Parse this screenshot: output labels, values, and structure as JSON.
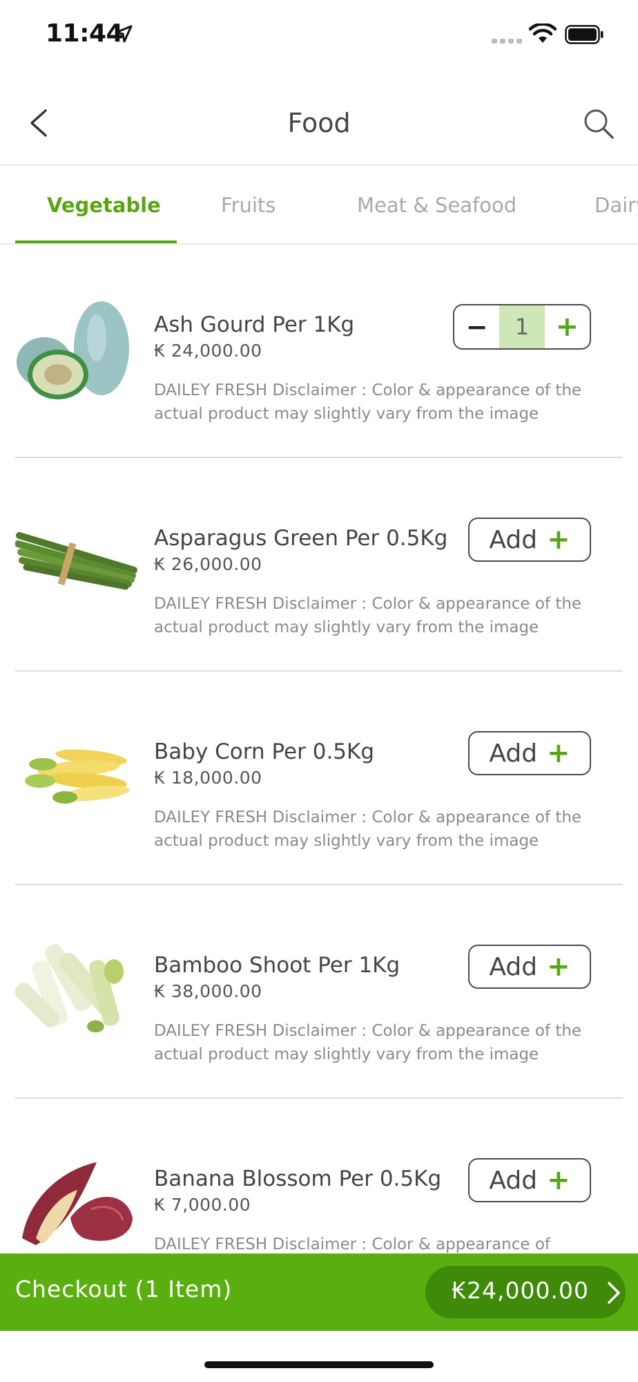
{
  "status": {
    "time": "11:44"
  },
  "nav": {
    "title": "Food"
  },
  "tabs": [
    "Vegetable",
    "Fruits",
    "Meat & Seafood",
    "Dairy"
  ],
  "products": [
    {
      "name": "Ash Gourd Per 1Kg",
      "price": "₭ 24,000.00",
      "disclaimer": "DAILEY FRESH Disclaimer : Color & appearance of the actual product may slightly vary from the image",
      "quantity": "1"
    },
    {
      "name": "Asparagus Green Per 0.5Kg",
      "price": "₭ 26,000.00",
      "disclaimer": "DAILEY FRESH Disclaimer : Color & appearance of the actual product may slightly vary from the image",
      "button": "Add"
    },
    {
      "name": "Baby Corn Per 0.5Kg",
      "price": "₭ 18,000.00",
      "disclaimer": "DAILEY FRESH Disclaimer : Color & appearance of the actual product may slightly vary from the image",
      "button": "Add"
    },
    {
      "name": "Bamboo Shoot  Per 1Kg",
      "price": "₭ 38,000.00",
      "disclaimer": "DAILEY FRESH Disclaimer : Color & appearance of the actual product may slightly vary from the image",
      "button": "Add"
    },
    {
      "name": "Banana Blossom Per 0.5Kg",
      "price": "₭ 7,000.00",
      "disclaimer": "DAILEY FRESH Disclaimer : Color & appearance of",
      "button": "Add"
    }
  ],
  "stepper": {
    "minus": "−",
    "plus": "+"
  },
  "add_plus": "+",
  "checkout": {
    "label": "Checkout (1 Item)",
    "total": "₭24,000.00"
  },
  "colors": {
    "accent": "#5aa514",
    "checkout_bar": "#5aaf10",
    "checkout_total_bg": "#3f8a08",
    "stepper_qty_bg": "#cde8b6"
  }
}
